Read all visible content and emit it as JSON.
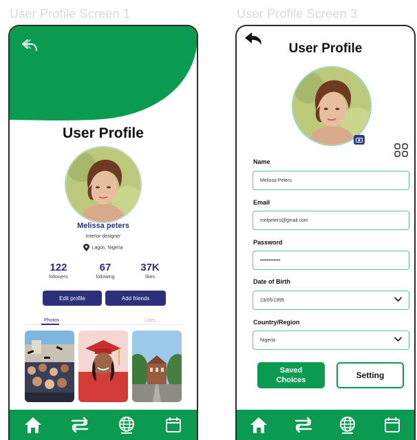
{
  "screens": {
    "screen1_caption": "User Profile Screen 1",
    "screen3_caption": "User Profile Screen 3"
  },
  "profile1": {
    "title": "User Profile",
    "name": "Melissa peters",
    "occupation": "Interior designer",
    "location": "Lagos, Nigeria",
    "stats": [
      {
        "value": "122",
        "label": "followers"
      },
      {
        "value": "67",
        "label": "following"
      },
      {
        "value": "37K",
        "label": "likes"
      }
    ],
    "edit_button": "Edit profile",
    "add_friends_button": "Add friends",
    "tabs": [
      "Photos",
      "Likes"
    ]
  },
  "profile3": {
    "title": "User Profile",
    "fields": {
      "name_label": "Name",
      "name_value": "Melissa Peters",
      "email_label": "Email",
      "email_value": "melpeters@gmail.com",
      "password_label": "Password",
      "password_value": "••••••••••••",
      "dob_label": "Date of Birth",
      "dob_value": "23/05/1995",
      "country_label": "Country/Region",
      "country_value": "Nigeria"
    },
    "saved_button_line1": "Saved",
    "saved_button_line2": "Choices",
    "setting_button": "Setting"
  },
  "icons": {
    "nav": [
      "home-icon",
      "transfer-icon",
      "globe-icon",
      "calendar-icon"
    ],
    "back": "back-arrow-icon",
    "location": "location-pin-icon",
    "camera": "camera-icon",
    "grid": "grid-icon",
    "chevron": "chevron-down-icon"
  },
  "colors": {
    "brand_green": "#0a9a50",
    "navy": "#2d2f7a",
    "field_border": "#5cc590"
  }
}
